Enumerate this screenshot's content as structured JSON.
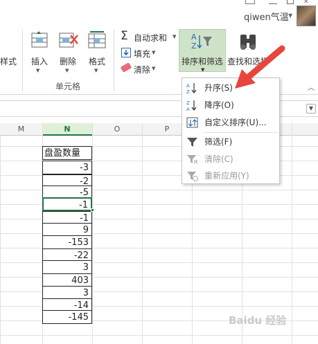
{
  "header": {
    "user_name": "qiwen气温",
    "min": "–",
    "max": "▢"
  },
  "ribbon": {
    "style_label": "样式",
    "insert_label": "插入",
    "delete_label": "删除",
    "format_label": "格式",
    "cells_group_label": "单元格",
    "autosum_label": "自动求和",
    "fill_label": "填充",
    "clear_label": "清除",
    "sort_filter_label": "排序和筛选",
    "find_select_label": "查找和选择"
  },
  "columns": [
    "M",
    "N",
    "O",
    "P"
  ],
  "sheet": {
    "header_cell": "盘盈数量",
    "values": [
      "-3",
      "-2",
      "-5",
      "-1",
      "-1",
      "9",
      "-153",
      "-22",
      "3",
      "403",
      "3",
      "-14",
      "-145"
    ]
  },
  "menu": {
    "items": [
      {
        "label": "升序(S)",
        "icon": "sort-ascending-icon",
        "enabled": true
      },
      {
        "label": "降序(O)",
        "icon": "sort-descending-icon",
        "enabled": true
      },
      {
        "label": "自定义排序(U)...",
        "icon": "custom-sort-icon",
        "enabled": true
      },
      {
        "label": "筛选(F)",
        "icon": "filter-icon",
        "enabled": true
      },
      {
        "label": "清除(C)",
        "icon": "clear-filter-icon",
        "enabled": false
      },
      {
        "label": "重新应用(Y)",
        "icon": "reapply-icon",
        "enabled": false
      }
    ]
  },
  "watermark": "Baidu 经验",
  "colors": {
    "accent": "#217346",
    "highlight": "#cfe3c8",
    "arrow": "#e8453c"
  }
}
